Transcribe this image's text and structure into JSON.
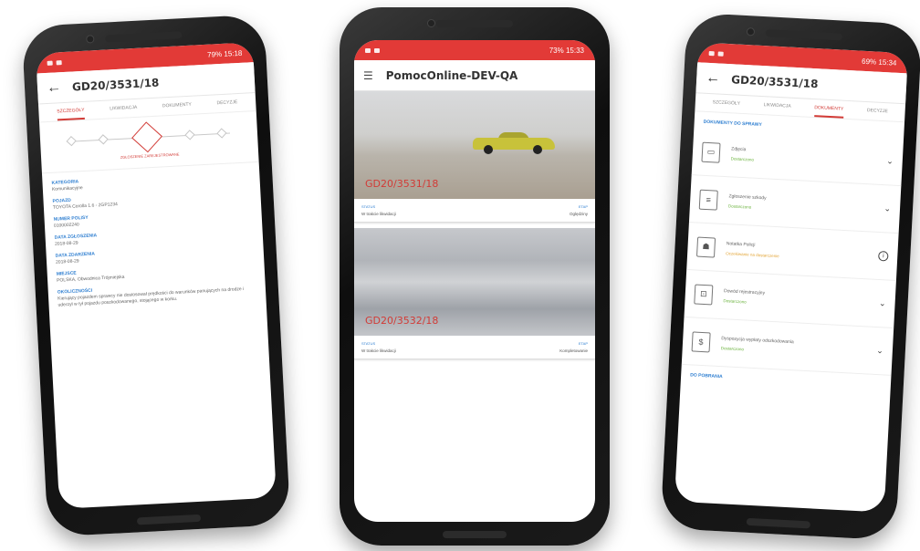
{
  "phones": {
    "left": {
      "status_time": "79% 15:18",
      "title": "GD20/3531/18",
      "tabs": [
        "SZCZEGÓŁY",
        "LIKWIDACJA",
        "DOKUMENTY",
        "DECYZJE"
      ],
      "active_tab": 0,
      "step_caption": "ZGŁOSZENIE ZAREJESTROWANE",
      "fields": [
        {
          "label": "KATEGORIA",
          "value": "Komunikacyjne"
        },
        {
          "label": "POJAZD",
          "value": "TOYOTA Corolla 1.6 - 2GP1234"
        },
        {
          "label": "NUMER POLISY",
          "value": "0100002240"
        },
        {
          "label": "DATA ZGŁOSZENIA",
          "value": "2018-08-29"
        },
        {
          "label": "DATA ZDARZENIA",
          "value": "2018-08-29"
        },
        {
          "label": "MIEJSCE",
          "value": "POLSKA, Obwodnica Trójmiejska"
        },
        {
          "label": "OKOLICZNOŚCI",
          "value": "Kierujący pojazdem sprawcy nie dostosował prędkości do warunków panujących na drodze i uderzył w tył pojazdu poszkodowanego, stojącego w korku."
        }
      ]
    },
    "center": {
      "status_time": "73% 15:33",
      "title": "PomocOnline-DEV-QA",
      "cards": [
        {
          "claim": "GD20/3531/18",
          "status_label": "STATUS",
          "status": "W trakcie likwidacji",
          "stage_label": "ETAP",
          "stage": "Oględziny",
          "image": "sand-yellow-car"
        },
        {
          "claim": "GD20/3532/18",
          "status_label": "STATUS",
          "status": "W trakcie likwidacji",
          "stage_label": "ETAP",
          "stage": "Kompletowanie",
          "image": "road-blur"
        }
      ]
    },
    "right": {
      "status_time": "69% 15:34",
      "title": "GD20/3531/18",
      "tabs": [
        "SZCZEGÓŁY",
        "LIKWIDACJA",
        "DOKUMENTY",
        "DECYZJE"
      ],
      "active_tab": 2,
      "section_docs": "DOKUMENTY DO SPRAWY",
      "documents": [
        {
          "name": "Zdjęcia",
          "status": "Dostarczono",
          "icon": "image-icon",
          "action": "chevron-down",
          "state": "ok"
        },
        {
          "name": "Zgłoszenie szkody",
          "status": "Dostarczono",
          "icon": "document-icon",
          "action": "chevron-down",
          "state": "ok"
        },
        {
          "name": "Notatka Policji",
          "status": "Oczekiwanie na dostarczenie",
          "icon": "police-icon",
          "action": "info",
          "state": "pending"
        },
        {
          "name": "Dowód rejestracyjny",
          "status": "Dostarczono",
          "icon": "car-document-icon",
          "action": "chevron-down",
          "state": "ok"
        },
        {
          "name": "Dyspozycja wypłaty odszkodowania",
          "status": "Dostarczono",
          "icon": "money-icon",
          "action": "chevron-down",
          "state": "ok"
        }
      ],
      "section_download": "DO POBRANIA"
    }
  },
  "colors": {
    "brand_red": "#e23a37",
    "link_blue": "#2f7fd1",
    "ok_green": "#6cb33f",
    "pending_orange": "#e3a537"
  }
}
